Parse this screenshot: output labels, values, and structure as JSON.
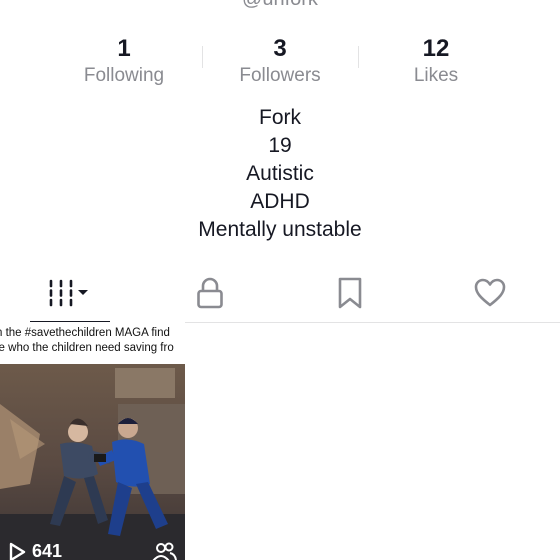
{
  "profile": {
    "username": "@unfork"
  },
  "stats": [
    {
      "value": "1",
      "label": "Following"
    },
    {
      "value": "3",
      "label": "Followers"
    },
    {
      "value": "12",
      "label": "Likes"
    }
  ],
  "bio": [
    "Fork",
    "19",
    "Autistic",
    "ADHD",
    "Mentally unstable"
  ],
  "tabs": {
    "videos": "grid-icon",
    "private": "lock-icon",
    "saved": "bookmark-icon",
    "liked": "heart-icon"
  },
  "videos": [
    {
      "caption_line_1": "n the #savethechildren MAGA  find",
      "caption_line_2": "le who the children need saving fro",
      "views": "641"
    }
  ],
  "colors": {
    "text": "#161823",
    "muted": "#8a8b91",
    "divider": "#e3e3e4"
  }
}
